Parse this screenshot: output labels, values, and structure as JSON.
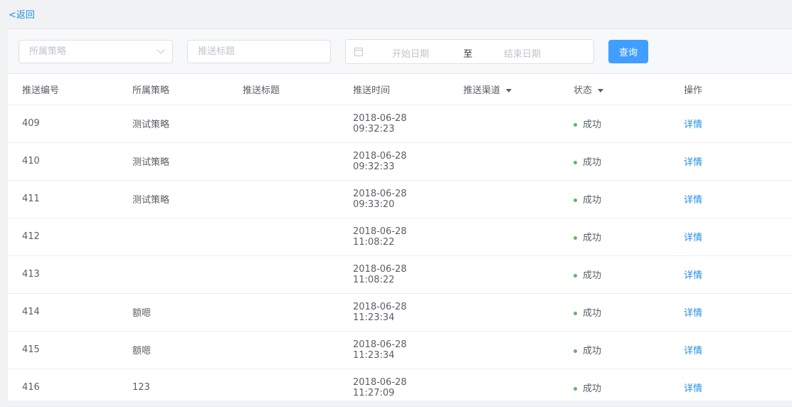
{
  "back_label": "<返回",
  "filters": {
    "strategy_placeholder": "所属策略",
    "title_placeholder": "推送标题",
    "start_date_placeholder": "开始日期",
    "range_separator": "至",
    "end_date_placeholder": "结束日期",
    "query_label": "查询"
  },
  "columns": [
    "推送编号",
    "所属策略",
    "推送标题",
    "推送时间",
    "推送渠道",
    "状态",
    "操作"
  ],
  "rows": [
    {
      "id": "409",
      "strategy": "测试策略",
      "title": "",
      "time": "2018-06-28 09:32:23",
      "channel": "",
      "status": "成功",
      "action": "详情"
    },
    {
      "id": "410",
      "strategy": "测试策略",
      "title": "",
      "time": "2018-06-28 09:32:33",
      "channel": "",
      "status": "成功",
      "action": "详情"
    },
    {
      "id": "411",
      "strategy": "测试策略",
      "title": "",
      "time": "2018-06-28 09:33:20",
      "channel": "",
      "status": "成功",
      "action": "详情"
    },
    {
      "id": "412",
      "strategy": "",
      "title": "",
      "time": "2018-06-28 11:08:22",
      "channel": "",
      "status": "成功",
      "action": "详情"
    },
    {
      "id": "413",
      "strategy": "",
      "title": "",
      "time": "2018-06-28 11:08:22",
      "channel": "",
      "status": "成功",
      "action": "详情"
    },
    {
      "id": "414",
      "strategy": "额嗯",
      "title": "",
      "time": "2018-06-28 11:23:34",
      "channel": "",
      "status": "成功",
      "action": "详情"
    },
    {
      "id": "415",
      "strategy": "额嗯",
      "title": "",
      "time": "2018-06-28 11:23:34",
      "channel": "",
      "status": "成功",
      "action": "详情"
    },
    {
      "id": "416",
      "strategy": "123",
      "title": "",
      "time": "2018-06-28 11:27:09",
      "channel": "",
      "status": "成功",
      "action": "详情"
    }
  ],
  "colors": {
    "accent": "#409eff",
    "link": "#1f8fe6",
    "success_dot": "#5cb85c"
  }
}
